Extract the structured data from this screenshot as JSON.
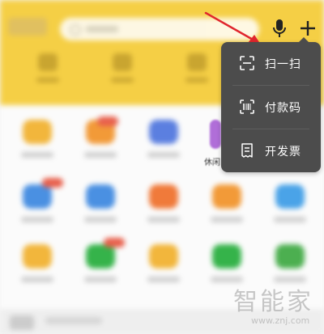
{
  "header": {
    "voice_icon": "microphone-icon",
    "add_icon": "plus-icon"
  },
  "popup_menu": {
    "items": [
      {
        "label": "扫一扫",
        "icon": "scan-icon"
      },
      {
        "label": "付款码",
        "icon": "barcode-icon"
      },
      {
        "label": "开发票",
        "icon": "invoice-icon"
      }
    ],
    "background": "#4c4c4c",
    "text_color": "#ffffff"
  },
  "background_grid": {
    "partial_label": "休闲"
  },
  "annotation": {
    "arrow_color": "#e0262d"
  },
  "watermark": {
    "name": "智能家",
    "url": "www.znj.com"
  },
  "colors": {
    "header_yellow": "#f5cf45",
    "tile_blue": "#4a90e2",
    "tile_orange": "#f29a38",
    "tile_green": "#35b34a",
    "badge_red": "#e8604c"
  }
}
